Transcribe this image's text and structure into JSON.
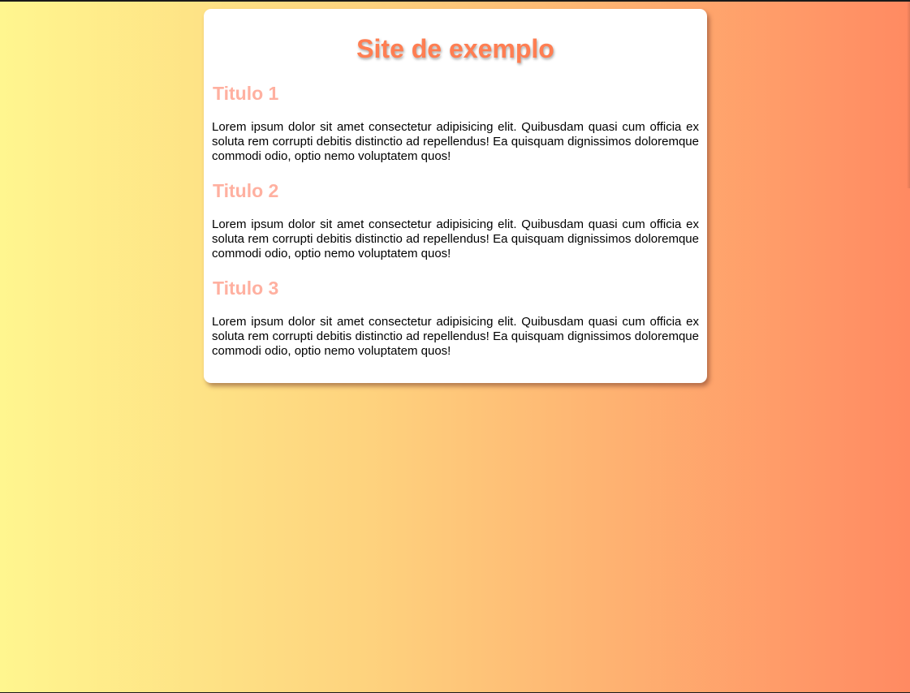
{
  "page": {
    "title": "Site de exemplo",
    "title_color": "#ff7e52",
    "heading_color": "#ffb0a0",
    "background_gradient": [
      "#fff68f",
      "#fed37e",
      "#ff8a62"
    ]
  },
  "sections": [
    {
      "heading": "Titulo 1",
      "text": "Lorem ipsum dolor sit amet consectetur adipisicing elit. Quibusdam quasi cum officia ex soluta rem corrupti debitis distinctio ad repellendus! Ea quisquam dignissimos doloremque commodi odio, optio nemo voluptatem quos!"
    },
    {
      "heading": "Titulo 2",
      "text": "Lorem ipsum dolor sit amet consectetur adipisicing elit. Quibusdam quasi cum officia ex soluta rem corrupti debitis distinctio ad repellendus! Ea quisquam dignissimos doloremque commodi odio, optio nemo voluptatem quos!"
    },
    {
      "heading": "Titulo 3",
      "text": "Lorem ipsum dolor sit amet consectetur adipisicing elit. Quibusdam quasi cum officia ex soluta rem corrupti debitis distinctio ad repellendus! Ea quisquam dignissimos doloremque commodi odio, optio nemo voluptatem quos!"
    }
  ]
}
